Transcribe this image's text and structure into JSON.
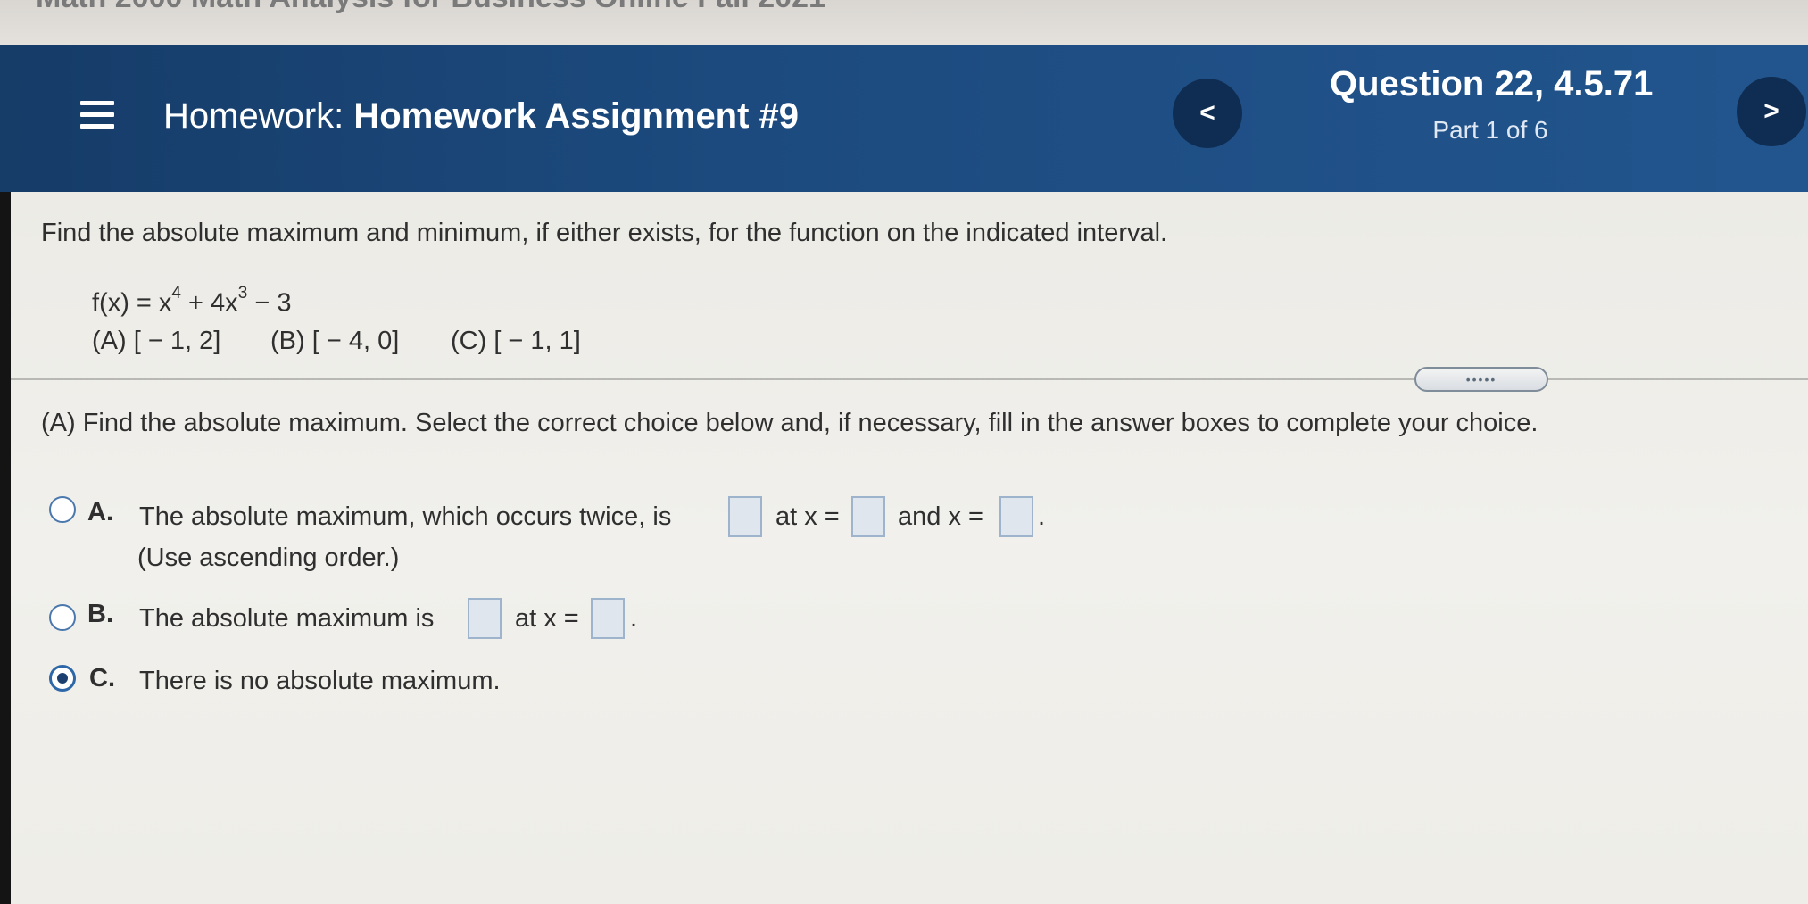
{
  "browser": {
    "tab_title": "Math 2000 Math Analysis for Business Online Fall 2021"
  },
  "header": {
    "menu_icon": "hamburger-menu-icon",
    "title_prefix": "Homework:",
    "title_name": "Homework Assignment #9",
    "question_title": "Question 22, 4.5.71",
    "question_part": "Part 1 of 6",
    "prev_label": "<",
    "next_label": ">",
    "colors": {
      "bar": "#1c4a7e",
      "nav_button": "#0f2d52"
    }
  },
  "problem": {
    "instructions": "Find the absolute maximum and minimum, if either exists, for the function on the indicated interval.",
    "function_lhs": "f(x) = x",
    "exp1": "4",
    "function_mid": " + 4x",
    "exp2": "3",
    "function_tail": " − 3",
    "intervals": [
      "(A) [ − 1, 2]",
      "(B) [ − 4, 0]",
      "(C) [ − 1, 1]"
    ]
  },
  "expand_label": "•••••",
  "part": {
    "prompt": "(A) Find the absolute maximum. Select the correct choice below and, if necessary, fill in the answer boxes to complete your choice.",
    "choices": [
      {
        "letter": "A.",
        "text1": "The absolute maximum, which occurs twice, is",
        "text2": "at x =",
        "text3": "and x =",
        "note": "(Use ascending order.)",
        "selected": false
      },
      {
        "letter": "B.",
        "text1": "The absolute maximum is",
        "text2": "at x =",
        "selected": false
      },
      {
        "letter": "C.",
        "text1": "There is no absolute maximum.",
        "selected": true
      }
    ]
  }
}
